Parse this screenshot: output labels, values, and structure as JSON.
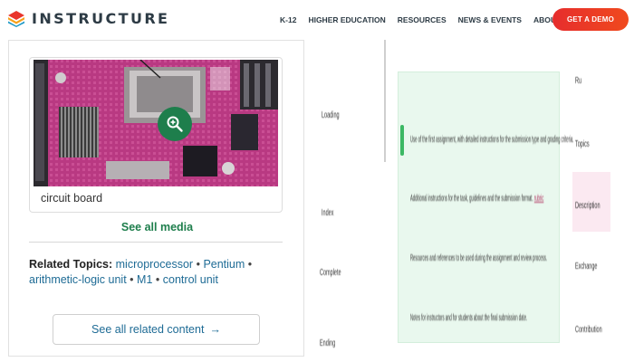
{
  "header": {
    "logo_text": "INSTRUCTURE",
    "nav": [
      "K-12",
      "HIGHER EDUCATION",
      "RESOURCES",
      "NEWS & EVENTS",
      "ABOUT US"
    ],
    "cta_label": "GET A DEMO",
    "cta_color": "#e9352b",
    "logo_colors": [
      "#e9352b",
      "#f7a11b",
      "#1b98c6"
    ]
  },
  "media_card": {
    "caption": "circuit board",
    "zoom_icon": "magnifier-plus-icon",
    "see_all_media": "See all media",
    "related_label": "Related Topics:",
    "related_topics": [
      "microprocessor",
      "Pentium",
      "arithmetic-logic unit",
      "M1",
      "control unit"
    ],
    "see_all_related": "See all related content",
    "arrow": "→",
    "accent_color": "#1e7e4c",
    "link_color": "#1e6b95"
  },
  "document": {
    "left_labels": [
      "Loading",
      "Index",
      "Complete",
      "Ending"
    ],
    "right_labels": [
      "Ru",
      "Topics",
      "Description",
      "Exchange",
      "Contribution"
    ],
    "panel_lines": [
      "Use of the first assignment, with detailed instructions for the submission type and grading criteria.",
      "Additional instructions for the task, guidelines and the submission format.",
      "Resources and references to be used during the assignment and review process.",
      "Notes for instructors and for students about the final submission date."
    ],
    "highlight_word": "rubric",
    "panel_color": "#e9f8ee",
    "bar_color": "#3cb864"
  }
}
